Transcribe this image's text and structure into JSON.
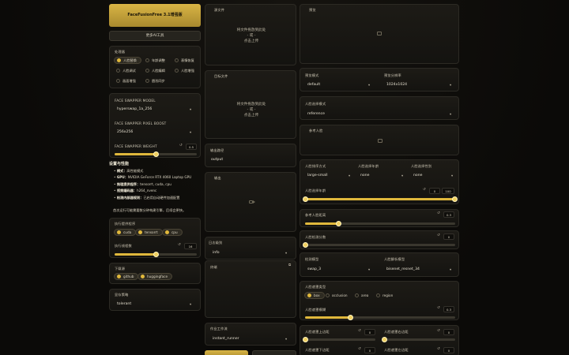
{
  "header": {
    "title": "FaceFusionFree 3.1增强版",
    "more": "更多AI工具"
  },
  "processors": {
    "label": "处理器",
    "items": [
      {
        "label": "人脸替换",
        "on": true
      },
      {
        "label": "年龄调整",
        "on": false
      },
      {
        "label": "表情恢复",
        "on": false
      },
      {
        "label": "人脸调试",
        "on": false
      },
      {
        "label": "人脸编辑",
        "on": false
      },
      {
        "label": "人脸增强",
        "on": false
      },
      {
        "label": "画面增强",
        "on": false
      },
      {
        "label": "唇形同步",
        "on": false
      }
    ]
  },
  "swapper": {
    "model_label": "FACE SWAPPER MODEL",
    "model": "hyperswap_1a_256",
    "boost_label": "FACE SWAPPER PIXEL BOOST",
    "boost": "256x256",
    "weight_label": "FACE SWAPPER WEIGHT",
    "weight": "0.5",
    "weight_frac": 0.5
  },
  "settings": {
    "title": "设置与性能",
    "lines": [
      {
        "k": "模式：",
        "v": "高性能模式"
      },
      {
        "k": "GPU：",
        "v": "NVIDIA GeForce RTX 4060 Laptop GPU"
      },
      {
        "k": "推理提供程序：",
        "v": "tensorrt, cuda, cpu"
      },
      {
        "k": "视频编码器：",
        "v": "h264_nvenc"
      },
      {
        "k": "检测内部器规则：",
        "v": "已启用自动硬件加速配置"
      }
    ],
    "hint": "首次运行可能需要数分钟构建引擎，后续会更快。"
  },
  "providers": {
    "label": "执行提供程序",
    "items": [
      {
        "label": "cuda",
        "on": true
      },
      {
        "label": "tensorrt",
        "on": true
      },
      {
        "label": "cpu",
        "on": true
      }
    ]
  },
  "threads": {
    "label": "执行线程数",
    "value": "16",
    "frac": 0.5
  },
  "download": {
    "label": "下载源",
    "items": [
      {
        "label": "github",
        "on": true
      },
      {
        "label": "huggingface",
        "on": true
      }
    ]
  },
  "memory": {
    "label": "显存策略",
    "value": "tolerant"
  },
  "source": {
    "label": "源文件",
    "drop": "将文件拖放到此处",
    "or": "- 或 -",
    "click": "点击上传"
  },
  "target": {
    "label": "目标文件",
    "drop": "将文件拖放到此处",
    "or": "- 或 -",
    "click": "点击上传"
  },
  "output_path": {
    "label": "输出路径",
    "value": "output"
  },
  "output": {
    "label": "输出"
  },
  "log_level": {
    "label": "日志级别",
    "value": "info"
  },
  "terminal": {
    "label": "终端"
  },
  "job": {
    "label": "作业工作流",
    "value": "instant_runner"
  },
  "preview": {
    "label": "预览"
  },
  "preview_mode": {
    "label": "预览模式",
    "value": "default"
  },
  "preview_res": {
    "label": "预览分辨率",
    "value": "1024x1024"
  },
  "selector_mode": {
    "label": "人脸选择模式",
    "value": "reference"
  },
  "ref_face": {
    "label": "参考人脸"
  },
  "analyser": {
    "order_label": "人脸排序方式",
    "order": "large-small",
    "age_label": "人脸选择年龄",
    "age": "none",
    "gender_label": "人脸选择性别",
    "gender": "none",
    "age_range_label": "人脸选择年龄",
    "age_min": "0",
    "age_max": "100"
  },
  "ref_distance": {
    "label": "参考人脸距离",
    "value": "0.3",
    "frac": 0.22
  },
  "detector_score": {
    "label": "人脸检测分数",
    "value": "0",
    "frac": 0.0
  },
  "detector": {
    "model_label": "检测模型",
    "model": "swap_3",
    "parser_label": "人脸解析模型",
    "parser": "bisenet_resnet_34"
  },
  "mask": {
    "type_label": "人脸遮罩类型",
    "types": [
      {
        "label": "box",
        "on": true
      },
      {
        "label": "occlusion",
        "on": false
      },
      {
        "label": "area",
        "on": false
      },
      {
        "label": "region",
        "on": false
      }
    ],
    "blur_label": "人脸遮罩模糊",
    "blur": "0.3",
    "blur_frac": 0.3
  },
  "padding": {
    "top_label": "人脸遮罩上边距",
    "top": "0",
    "right_label": "人脸遮罩右边距",
    "right": "0",
    "bottom_label": "人脸遮罩下边距",
    "bottom": "0",
    "left_label": "人脸遮罩左边距",
    "left": "0"
  },
  "icons": {
    "dropdown": "chevron-down-icon",
    "reset": "reset-icon",
    "image": "image-icon",
    "video": "video-icon",
    "copy": "copy-icon"
  },
  "colors": {
    "accent": "#e0b83c",
    "panel": "#1a1814",
    "bg": "#0b0a08"
  }
}
